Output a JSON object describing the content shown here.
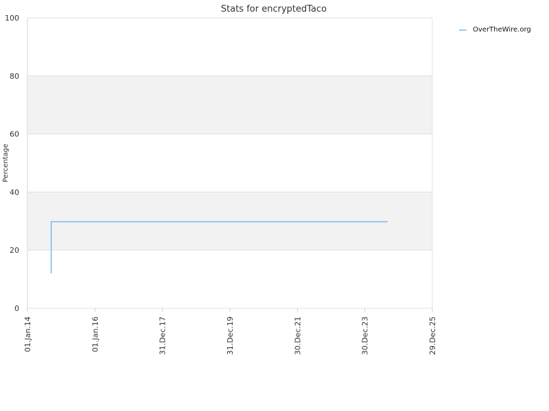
{
  "chart_data": {
    "type": "line",
    "title": "Stats for encryptedTaco",
    "xlabel": "",
    "ylabel": "Percentage",
    "ylim": [
      0,
      100
    ],
    "yticks": [
      0,
      20,
      40,
      60,
      80,
      100
    ],
    "xlim": [
      "2014-01-01",
      "2025-12-29"
    ],
    "xtick_labels": [
      "01.Jan.14",
      "01.Jan.16",
      "31.Dec.17",
      "31.Dec.19",
      "30.Dec.21",
      "30.Dec.23",
      "29.Dec.25"
    ],
    "xtick_dates": [
      "2014-01-01",
      "2016-01-01",
      "2017-12-31",
      "2019-12-31",
      "2021-12-30",
      "2023-12-30",
      "2025-12-29"
    ],
    "grid": "alternating horizontal bands",
    "legend_position": "top-right",
    "series": [
      {
        "name": "OverTheWire.org",
        "color": "#7cb5ec",
        "points": [
          {
            "x": "2014-09-15",
            "y": 12
          },
          {
            "x": "2014-09-15",
            "y": 29.8
          },
          {
            "x": "2024-09-01",
            "y": 29.8
          }
        ]
      }
    ]
  }
}
